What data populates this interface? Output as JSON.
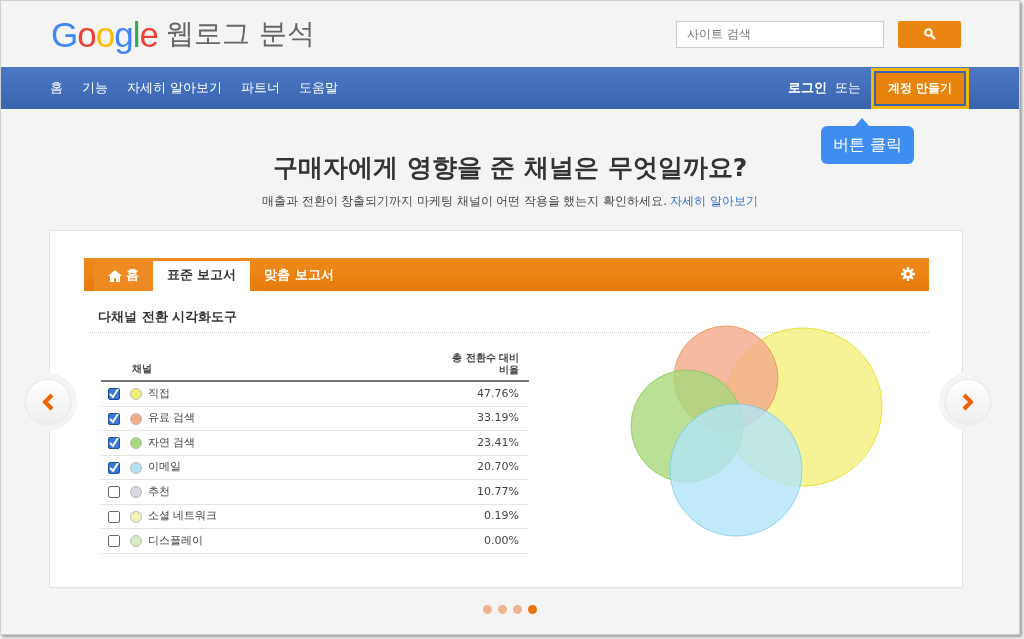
{
  "header": {
    "logo": "Google",
    "product": "웹로그 분석",
    "search": {
      "placeholder": "사이트 검색"
    }
  },
  "nav": {
    "items": [
      {
        "label": "홈"
      },
      {
        "label": "기능"
      },
      {
        "label": "자세히 알아보기"
      },
      {
        "label": "파트너"
      },
      {
        "label": "도움말"
      }
    ],
    "login": "로그인",
    "or": "또는",
    "signup": "계정 만들기",
    "signup_highlighted": true,
    "tooltip": "버튼 클릭"
  },
  "hero": {
    "title": "구매자에게 영향을 준 채널은 무엇일까요?",
    "subtitle": "매출과 전환이 창출되기까지 마케팅 채널이 어떤 작용을 했는지 확인하세요.",
    "link": "자세히 알아보기"
  },
  "report": {
    "tabs": [
      {
        "label": "홈",
        "selected": false,
        "kind": "home"
      },
      {
        "label": "표준 보고서",
        "selected": true,
        "kind": "text"
      },
      {
        "label": "맞춤 보고서",
        "selected": false,
        "kind": "text"
      }
    ],
    "title": "다채널 전환 시각화도구",
    "columns": [
      "채널",
      "총 전환수 대비 비율"
    ],
    "rows": [
      {
        "name": "직접",
        "value": "47.76%",
        "checked": true,
        "color": "#f2f07a"
      },
      {
        "name": "유료 검색",
        "value": "33.19%",
        "checked": true,
        "color": "#f3a98a"
      },
      {
        "name": "자연 검색",
        "value": "23.41%",
        "checked": true,
        "color": "#a8d87a"
      },
      {
        "name": "이메일",
        "value": "20.70%",
        "checked": true,
        "color": "#b3e3f7"
      },
      {
        "name": "추천",
        "value": "10.77%",
        "checked": false,
        "color": "#d6d8e2"
      },
      {
        "name": "소셜 네트워크",
        "value": "0.19%",
        "checked": false,
        "color": "#f5f2b8"
      },
      {
        "name": "디스플레이",
        "value": "0.00%",
        "checked": false,
        "color": "#d5efc2"
      }
    ]
  },
  "carousel_dots": [
    {
      "selected": false
    },
    {
      "selected": false
    },
    {
      "selected": false
    },
    {
      "selected": true
    }
  ]
}
